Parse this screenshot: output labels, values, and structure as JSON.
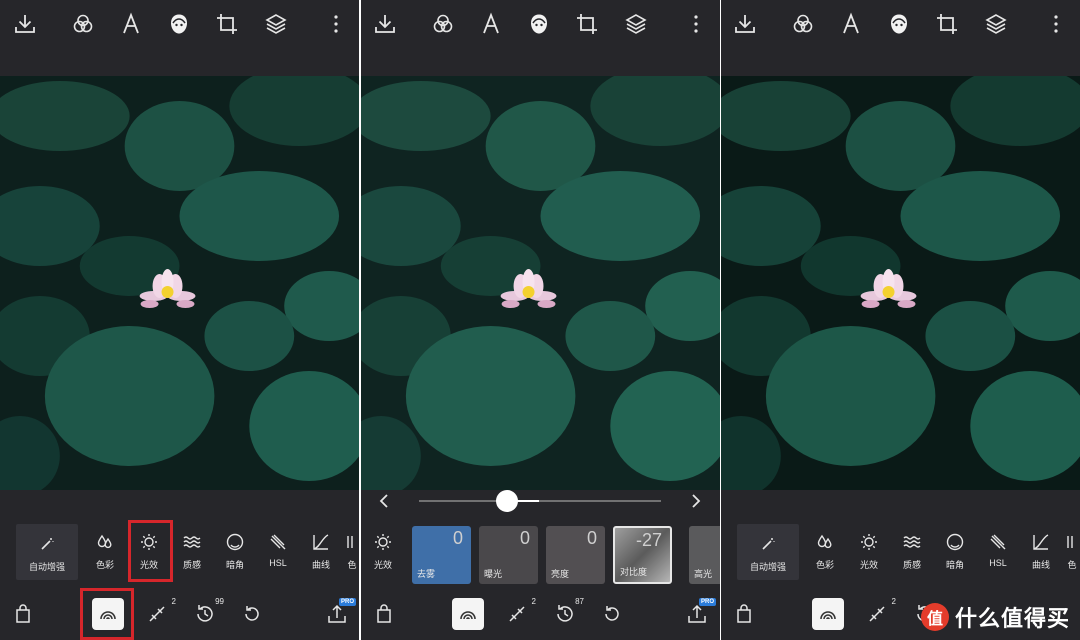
{
  "icons": {
    "top_toolbar": [
      "download-icon",
      "filter-icon",
      "text-icon",
      "face-icon",
      "crop-icon",
      "layers-icon",
      "more-icon"
    ],
    "bottom_bar": [
      "bag-icon",
      "adjust-icon",
      "healing-icon",
      "history-icon",
      "undo-icon",
      "export-icon"
    ]
  },
  "panel1": {
    "auto_enhance_label": "自动增强",
    "tools": [
      {
        "label": "色彩",
        "icon": "drops-icon"
      },
      {
        "label": "光效",
        "icon": "sun-icon"
      },
      {
        "label": "质感",
        "icon": "waves-icon"
      },
      {
        "label": "暗角",
        "icon": "vignette-icon"
      },
      {
        "label": "HSL",
        "icon": "brush-icon"
      },
      {
        "label": "曲线",
        "icon": "curve-icon"
      },
      {
        "label": "色",
        "icon": "partial-icon"
      }
    ],
    "bottom_badges": {
      "healing": "2",
      "history": "99",
      "export_badge": "PRO"
    },
    "highlight_color": "#d6262b"
  },
  "panel2": {
    "tool_label": "光效",
    "cards": [
      {
        "label": "去雾",
        "value": "0"
      },
      {
        "label": "曝光",
        "value": "0"
      },
      {
        "label": "亮度",
        "value": "0"
      },
      {
        "label": "对比度",
        "value": "-27"
      },
      {
        "label": "高光",
        "value": ""
      }
    ],
    "bottom_badges": {
      "healing": "2",
      "history": "87",
      "export_badge": "PRO"
    }
  },
  "panel3": {
    "auto_enhance_label": "自动增强",
    "tools": [
      {
        "label": "色彩"
      },
      {
        "label": "光效"
      },
      {
        "label": "质感"
      },
      {
        "label": "暗角"
      },
      {
        "label": "HSL"
      },
      {
        "label": "曲线"
      },
      {
        "label": "色"
      }
    ],
    "bottom_badges": {
      "healing": "2"
    }
  },
  "watermark": {
    "badge": "值",
    "text": "什么值得买"
  },
  "colors": {
    "panel_bg": "#26262a",
    "active_card": "#3f6fa8",
    "pro": "#2a7bd9"
  }
}
